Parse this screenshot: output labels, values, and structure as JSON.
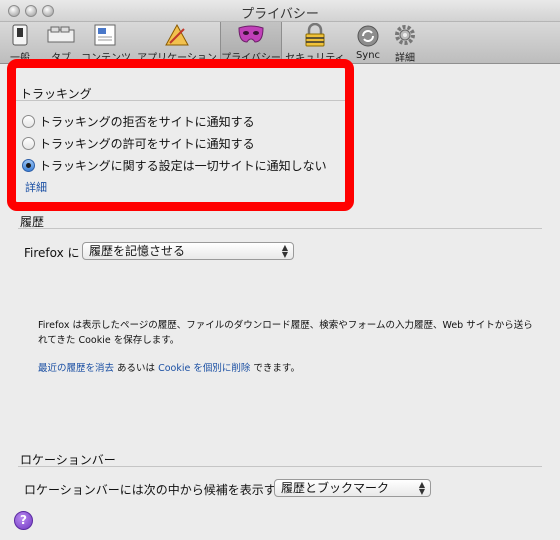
{
  "window": {
    "title": "プライバシー"
  },
  "toolbar": {
    "items": [
      {
        "label": "一般"
      },
      {
        "label": "タブ"
      },
      {
        "label": "コンテンツ"
      },
      {
        "label": "アプリケーション"
      },
      {
        "label": "プライバシー"
      },
      {
        "label": "セキュリティ"
      },
      {
        "label": "Sync"
      },
      {
        "label": "詳細"
      }
    ]
  },
  "tracking": {
    "heading": "トラッキング",
    "options": [
      {
        "label": "トラッキングの拒否をサイトに通知する",
        "selected": false
      },
      {
        "label": "トラッキングの許可をサイトに通知する",
        "selected": false
      },
      {
        "label": "トラッキングに関する設定は一切サイトに通知しない",
        "selected": true
      }
    ],
    "details_link": "詳細"
  },
  "history": {
    "heading": "履歴",
    "prefix": "Firefox に",
    "select_value": "履歴を記憶させる",
    "description": "Firefox は表示したページの履歴、ファイルのダウンロード履歴、検索やフォームの入力履歴、Web サイトから送られてきた Cookie を保存します。",
    "clear_link": "最近の履歴を消去",
    "or_text": "あるいは",
    "cookie_link": "Cookie を個別に削除",
    "suffix": "できます。"
  },
  "location_bar": {
    "heading": "ロケーションバー",
    "label": "ロケーションバーには次の中から候補を表示する:",
    "select_value": "履歴とブックマーク"
  },
  "help": {
    "label": "?"
  }
}
